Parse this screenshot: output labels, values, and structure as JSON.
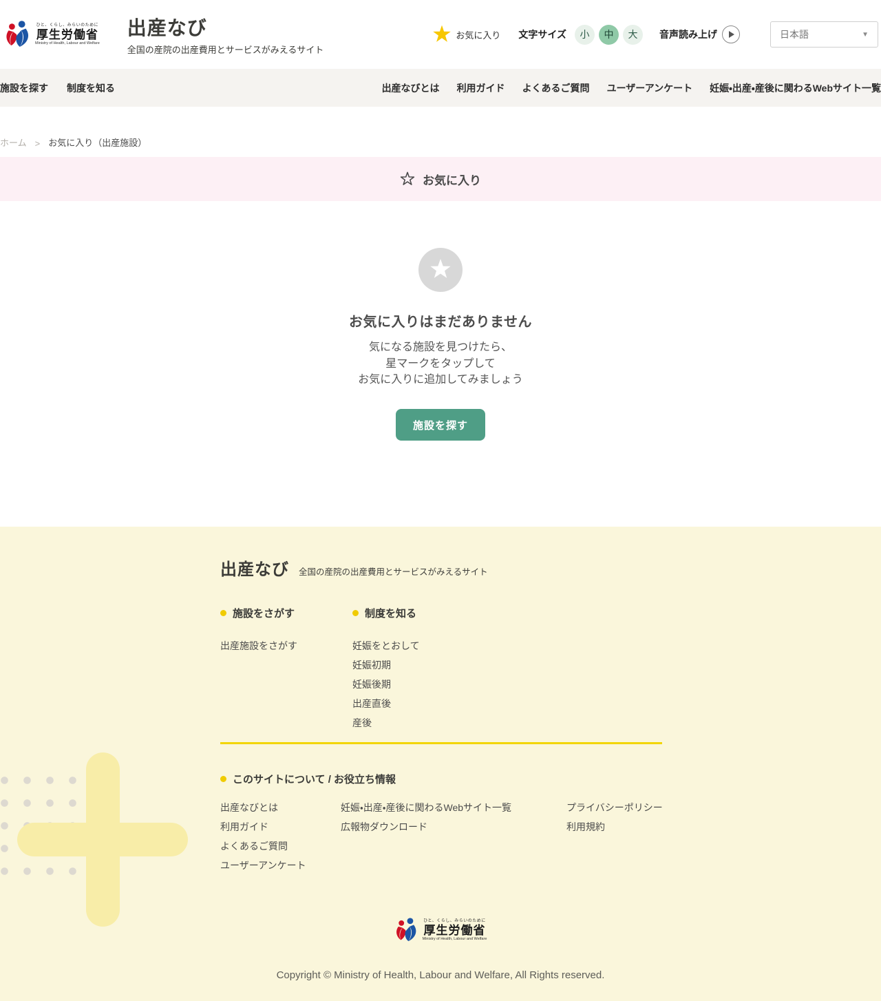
{
  "header": {
    "logo": {
      "tagline": "ひと、くらし、みらいのために",
      "name": "厚生労働省",
      "name_en": "Ministry of Health, Labour and Welfare"
    },
    "site_title": "出産なび",
    "site_subtitle": "全国の産院の出産費用とサービスがみえるサイト",
    "favorites_label": "お気に入り",
    "text_size_label": "文字サイズ",
    "text_size_small": "小",
    "text_size_medium": "中",
    "text_size_large": "大",
    "tts_label": "音声読み上げ",
    "language_value": "日本語",
    "language_caret": "▼"
  },
  "nav": {
    "left": [
      "施設を探す",
      "制度を知る"
    ],
    "right": [
      "出産なびとは",
      "利用ガイド",
      "よくあるご質問",
      "ユーザーアンケート",
      "妊娠・出産・産後に関わるWebサイト一覧"
    ]
  },
  "breadcrumb": {
    "home": "ホーム",
    "separator": ">",
    "current": "お気に入り（出産施設）"
  },
  "banner": {
    "title": "お気に入り"
  },
  "empty_state": {
    "title": "お気に入りはまだありません",
    "line1": "気になる施設を見つけたら、",
    "line2": "星マークをタップして",
    "line3": "お気に入りに追加してみましょう",
    "button_label": "施設を探す"
  },
  "footer": {
    "site_title": "出産なび",
    "site_subtitle": "全国の産院の出産費用とサービスがみえるサイト",
    "facility_section": {
      "heading": "施設をさがす",
      "links": [
        "出産施設をさがす"
      ]
    },
    "system_section": {
      "heading": "制度を知る",
      "links": [
        "妊娠をとおして",
        "妊娠初期",
        "妊娠後期",
        "出産直後",
        "産後"
      ]
    },
    "about_section": {
      "heading": "このサイトについて / お役立ち情報",
      "col1": [
        "出産なびとは",
        "利用ガイド",
        "よくあるご質問",
        "ユーザーアンケート"
      ],
      "col2": [
        "妊娠・出産・産後に関わるWebサイト一覧",
        "広報物ダウンロード"
      ],
      "col3": [
        "プライバシーポリシー",
        "利用規約"
      ]
    },
    "logo": {
      "tagline": "ひと、くらし、みらいのために",
      "name": "厚生労働省",
      "name_en": "Ministry of Health, Labour and Welfare"
    },
    "copyright": "Copyright © Ministry of Health, Labour and Welfare, All Rights reserved."
  },
  "colors": {
    "accent_star_yellow": "#f7c700",
    "button_green": "#4f9e86",
    "selected_size_green": "#8fc9a7",
    "banner_pink": "#fdf0f5",
    "footer_yellow": "#faf6db",
    "divider_yellow": "#f2d500",
    "nav_gray": "#f5f3f0"
  }
}
